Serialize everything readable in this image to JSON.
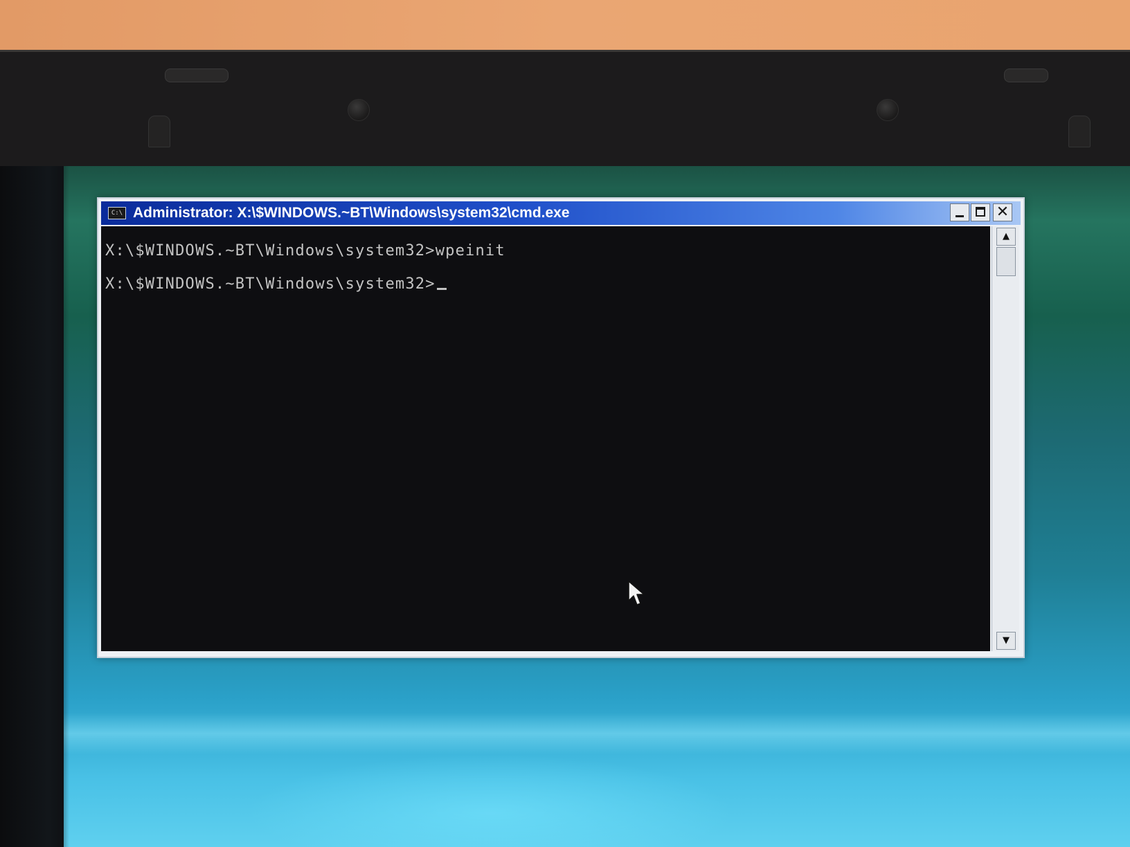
{
  "window": {
    "title": "Administrator: X:\\$WINDOWS.~BT\\Windows\\system32\\cmd.exe",
    "icon_text": "C:\\",
    "buttons": {
      "minimize": "minimize-icon",
      "maximize": "maximize-icon",
      "close": "close-icon",
      "close_glyph": "✕"
    }
  },
  "console": {
    "lines": [
      "X:\\$WINDOWS.~BT\\Windows\\system32>wpeinit",
      "X:\\$WINDOWS.~BT\\Windows\\system32>"
    ],
    "text_color": "#c3c3c3",
    "background_color": "#0e0e11"
  },
  "scrollbar": {
    "up_arrow": "▲",
    "down_arrow": "▼"
  },
  "theme": {
    "title_bar_start": "#0a2c9b",
    "title_bar_end": "#a9c7f4",
    "desktop_accent": "#2aa0c8"
  }
}
